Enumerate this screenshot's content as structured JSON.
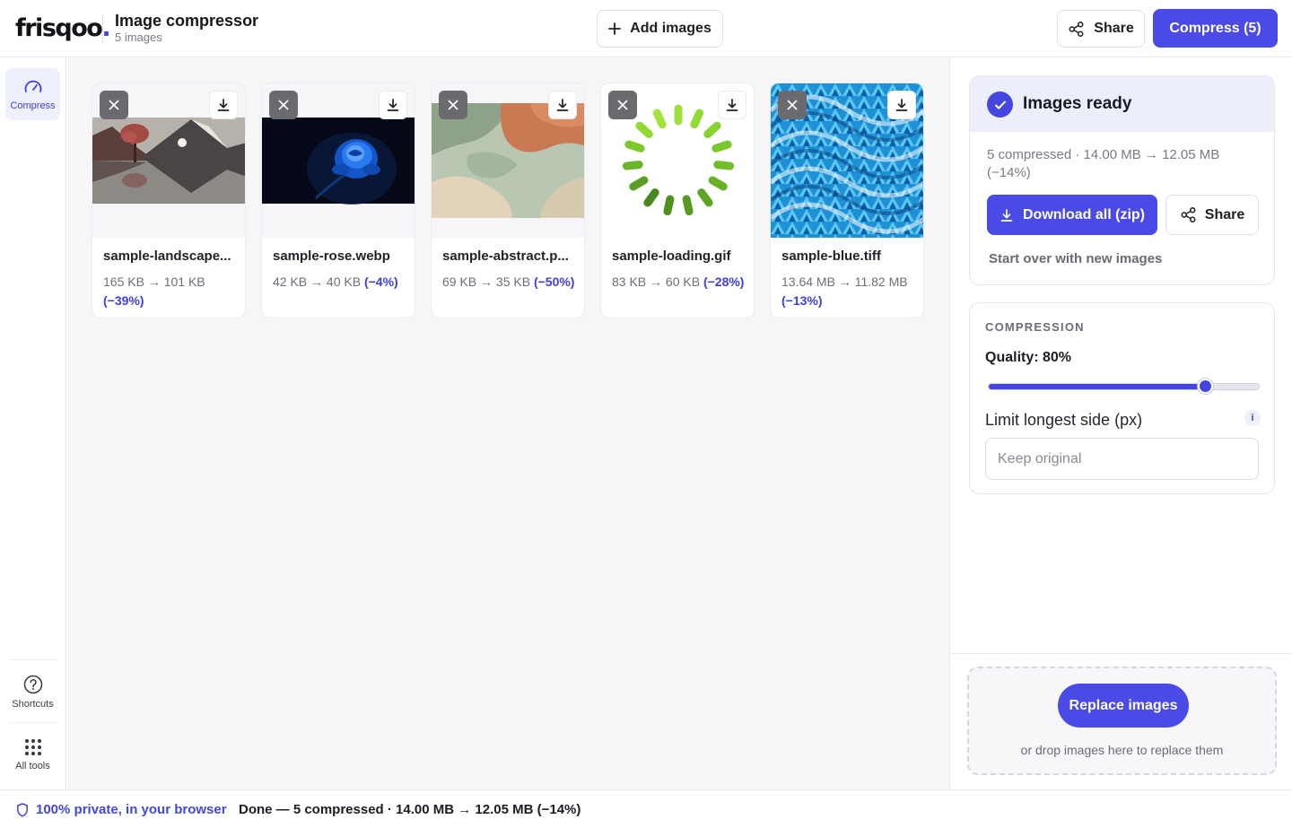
{
  "header": {
    "logo_text": "frisqoo",
    "logo_dot": ".",
    "title": "Image compressor",
    "subtitle": "5 images",
    "add_images_label": "Add images",
    "share_label": "Share",
    "compress_label": "Compress (5)"
  },
  "rail": {
    "compress_label": "Compress",
    "shortcuts_label": "Shortcuts",
    "all_tools_label": "All tools"
  },
  "images": [
    {
      "name": "sample-landscape...",
      "size_before": "165 KB",
      "size_after": "101 KB",
      "reduction": "(−39%)",
      "thumb": "landscape"
    },
    {
      "name": "sample-rose.webp",
      "size_before": "42 KB",
      "size_after": "40 KB",
      "reduction": "(−4%)",
      "thumb": "rose"
    },
    {
      "name": "sample-abstract.p...",
      "size_before": "69 KB",
      "size_after": "35 KB",
      "reduction": "(−50%)",
      "thumb": "abstract"
    },
    {
      "name": "sample-loading.gif",
      "size_before": "83 KB",
      "size_after": "60 KB",
      "reduction": "(−28%)",
      "thumb": "loading"
    },
    {
      "name": "sample-blue.tiff",
      "size_before": "13.64 MB",
      "size_after": "11.82 MB",
      "reduction": "(−13%)",
      "thumb": "blue-pattern"
    }
  ],
  "ready": {
    "title": "Images ready",
    "summary": "5 compressed · 14.00 MB → 12.05 MB (−14%)",
    "download_all_label": "Download all (zip)",
    "share_label": "Share",
    "start_over_label": "Start over with new images"
  },
  "compression": {
    "section_label": "COMPRESSION",
    "quality_label": "Quality: 80%",
    "quality_value": 80,
    "limit_label": "Limit longest side (px)",
    "info_icon_text": "i",
    "limit_placeholder": "Keep original",
    "limit_value": ""
  },
  "replace": {
    "button_label": "Replace images",
    "hint": "or drop images here to replace them"
  },
  "footer": {
    "privacy_text": "100% private, in your browser",
    "status_text": "Done — 5 compressed · 14.00 MB → 12.05 MB (−14%)"
  },
  "colors": {
    "accent": "#4a4ae6",
    "accent_soft": "#edeefb",
    "text": "#1a1a1f",
    "muted": "#7a7a84"
  }
}
